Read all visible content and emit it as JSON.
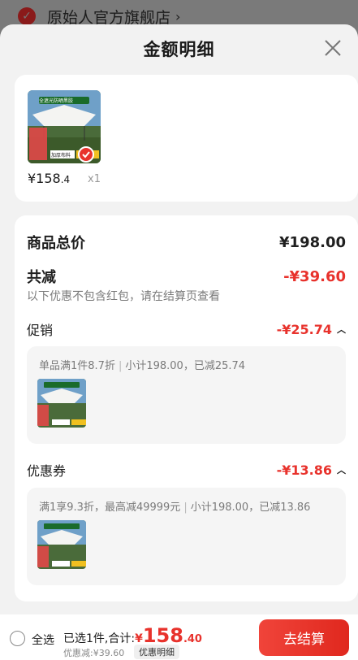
{
  "background": {
    "store_name": "原始人官方旗舰店",
    "store_chevron": "›"
  },
  "sheet": {
    "title": "金额明细",
    "close_icon": "close-icon"
  },
  "product": {
    "price_int": "¥158",
    "price_dec": ".4",
    "qty": "x1",
    "image_texts": {
      "banner": "全遮光防晒黑胶",
      "tag1": "加厚布料"
    }
  },
  "detail": {
    "total_label": "商品总价",
    "total_value": "¥198.00",
    "reduce_label": "共减",
    "reduce_value": "-¥39.60",
    "note": "以下优惠不包含红包，请在结算页查看",
    "promo": {
      "label": "促销",
      "value": "-¥25.74",
      "rule": "单品满1件8.7折",
      "summary": "小计198.00，已减25.74"
    },
    "coupon": {
      "label": "优惠券",
      "value": "-¥13.86",
      "rule": "满1享9.3折，最高减49999元",
      "summary": "小计198.00，已减13.86"
    }
  },
  "bottom": {
    "select_all": "全选",
    "selected_prefix": "已选1件,合计:",
    "total_cur": "¥",
    "total_int": "158",
    "total_dec": ".40",
    "discount": "优惠减:¥39.60",
    "discount_detail": "优惠明细",
    "checkout": "去结算"
  },
  "colors": {
    "accent": "#e8322c",
    "sheet_bg": "#f2f2f2"
  }
}
